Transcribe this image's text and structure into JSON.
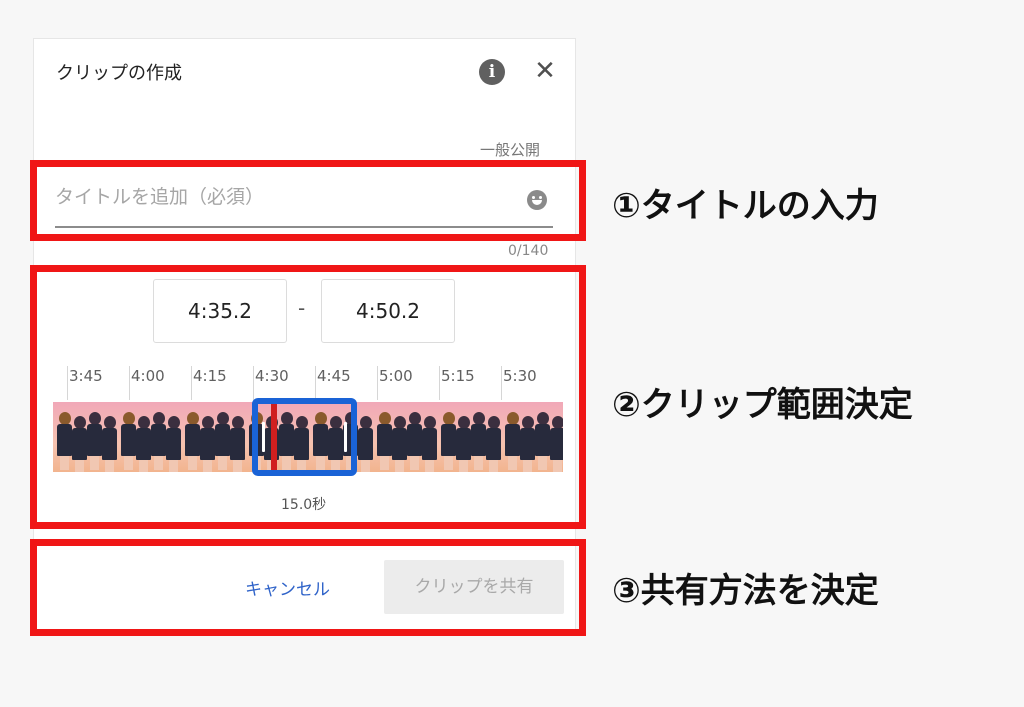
{
  "dialog": {
    "title": "クリップの作成",
    "info_icon": "i",
    "close_icon": "✕",
    "visibility": "一般公開",
    "title_placeholder": "タイトルを追加（必須）",
    "char_counter": "0/140",
    "start_time": "4:35.2",
    "separator": "-",
    "end_time": "4:50.2",
    "timeline_ticks": [
      "3:45",
      "4:00",
      "4:15",
      "4:30",
      "4:45",
      "5:00",
      "5:15",
      "5:30"
    ],
    "duration": "15.0秒",
    "cancel_label": "キャンセル",
    "share_label": "クリップを共有"
  },
  "annotations": {
    "step1": "①タイトルの入力",
    "step2": "②クリップ範囲決定",
    "step3": "③共有方法を決定"
  },
  "colors": {
    "highlight": "#f01616",
    "selection": "#1a63d6",
    "playhead": "#d01f1f",
    "link": "#2f63c9"
  },
  "icons": {
    "info": "info-icon",
    "close": "close-icon",
    "emoji": "emoji-icon"
  }
}
